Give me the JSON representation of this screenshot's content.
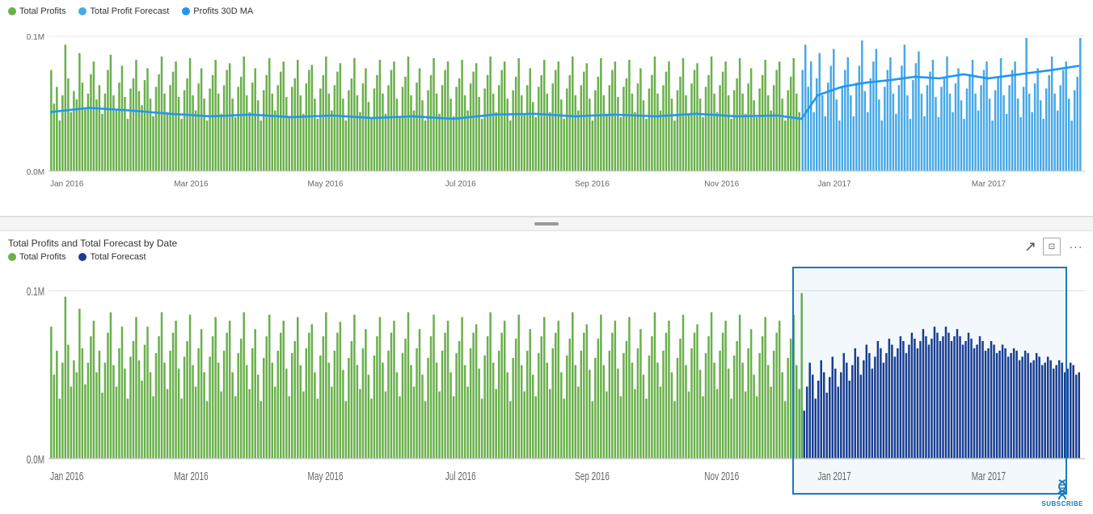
{
  "top_chart": {
    "legend": [
      {
        "label": "Total Profits",
        "color": "#6ab04c",
        "type": "bar"
      },
      {
        "label": "Total Profit Forecast",
        "color": "#48a9e6",
        "type": "bar"
      },
      {
        "label": "Profits 30D MA",
        "color": "#2196f3",
        "type": "line"
      }
    ],
    "y_axis": [
      "0.1M",
      "0.0M"
    ],
    "x_axis": [
      "Jan 2016",
      "Mar 2016",
      "May 2016",
      "Jul 2016",
      "Sep 2016",
      "Nov 2016",
      "Jan 2017",
      "Mar 2017"
    ]
  },
  "bottom_chart": {
    "title": "Total Profits and Total Forecast by Date",
    "legend": [
      {
        "label": "Total Profits",
        "color": "#6ab04c",
        "type": "bar"
      },
      {
        "label": "Total Forecast",
        "color": "#1a3c8f",
        "type": "bar"
      }
    ],
    "y_axis": [
      "0.1M",
      "0.0M"
    ],
    "x_axis": [
      "Jan 2016",
      "Mar 2016",
      "May 2016",
      "Jul 2016",
      "Sep 2016",
      "Nov 2016",
      "Jan 2017",
      "Mar 2017"
    ],
    "selection": {
      "label": "Jan 2017 - Mar 2017"
    }
  },
  "controls": {
    "expand_icon": "⊡",
    "more_icon": "···",
    "cursor_icon": "↗"
  },
  "subscribe": {
    "label": "SUBSCRIBE"
  }
}
